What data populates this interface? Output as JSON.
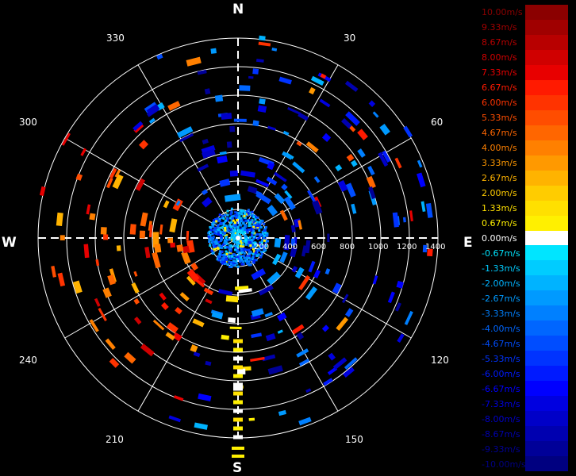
{
  "compass": {
    "north": "N",
    "east": "E",
    "south": "S",
    "west": "W"
  },
  "bearing_labels": [
    "30",
    "60",
    "120",
    "150",
    "210",
    "240",
    "300",
    "330"
  ],
  "range_labels": [
    "200",
    "400",
    "600",
    "800",
    "1000",
    "1200",
    "1400"
  ],
  "legend": [
    {
      "label": "10.00m/s",
      "color": "#8b0000"
    },
    {
      "label": "9.33m/s",
      "color": "#a00000"
    },
    {
      "label": "8.67m/s",
      "color": "#b80000"
    },
    {
      "label": "8.00m/s",
      "color": "#d00000"
    },
    {
      "label": "7.33m/s",
      "color": "#e80000"
    },
    {
      "label": "6.67m/s",
      "color": "#ff1a00"
    },
    {
      "label": "6.00m/s",
      "color": "#ff3300"
    },
    {
      "label": "5.33m/s",
      "color": "#ff4d00"
    },
    {
      "label": "4.67m/s",
      "color": "#ff6600"
    },
    {
      "label": "4.00m/s",
      "color": "#ff8000"
    },
    {
      "label": "3.33m/s",
      "color": "#ff9900"
    },
    {
      "label": "2.67m/s",
      "color": "#ffb300"
    },
    {
      "label": "2.00m/s",
      "color": "#ffcc00"
    },
    {
      "label": "1.33m/s",
      "color": "#ffe000"
    },
    {
      "label": "0.67m/s",
      "color": "#fff000"
    },
    {
      "label": "0.00m/s",
      "color": "#ffffff"
    },
    {
      "label": "-0.67m/s",
      "color": "#00e5ff"
    },
    {
      "label": "-1.33m/s",
      "color": "#00ccff"
    },
    {
      "label": "-2.00m/s",
      "color": "#00b3ff"
    },
    {
      "label": "-2.67m/s",
      "color": "#009aff"
    },
    {
      "label": "-3.33m/s",
      "color": "#0080ff"
    },
    {
      "label": "-4.00m/s",
      "color": "#0066ff"
    },
    {
      "label": "-4.67m/s",
      "color": "#004dff"
    },
    {
      "label": "-5.33m/s",
      "color": "#0033ff"
    },
    {
      "label": "-6.00m/s",
      "color": "#001aff"
    },
    {
      "label": "-6.67m/s",
      "color": "#0000ff"
    },
    {
      "label": "-7.33m/s",
      "color": "#0000e0"
    },
    {
      "label": "-8.00m/s",
      "color": "#0000c8"
    },
    {
      "label": "-8.67m/s",
      "color": "#0000b0"
    },
    {
      "label": "-9.33m/s",
      "color": "#000098"
    },
    {
      "label": "-10.00m/s",
      "color": "#000080"
    }
  ]
}
